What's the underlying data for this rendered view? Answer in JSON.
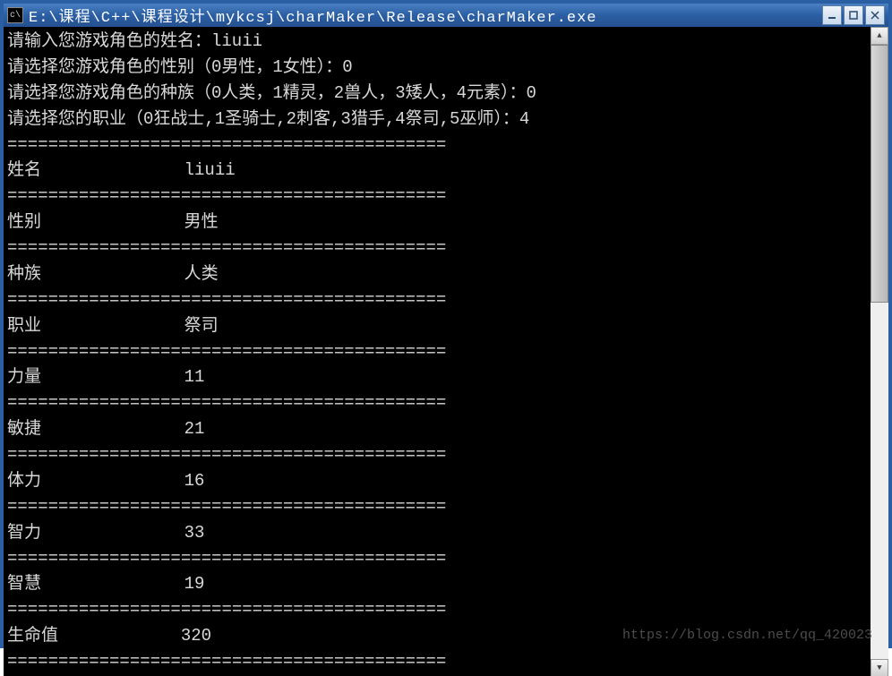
{
  "window": {
    "title": "E:\\课程\\C++\\课程设计\\mykcsj\\charMaker\\Release\\charMaker.exe"
  },
  "prompts": {
    "name_prompt": "请输入您游戏角色的姓名：",
    "name_input": "liuii",
    "gender_prompt": "请选择您游戏角色的性别（0男性，1女性）：",
    "gender_input": "0",
    "race_prompt": "请选择您游戏角色的种族（0人类，1精灵，2兽人，3矮人，4元素）：",
    "race_input": "0",
    "job_prompt": "请选择您的职业（0狂战士,1圣骑士,2刺客,3猎手,4祭司,5巫师）：",
    "job_input": "4"
  },
  "separator": "===========================================",
  "stats": [
    {
      "label": "姓名",
      "value": "liuii"
    },
    {
      "label": "性别",
      "value": "男性"
    },
    {
      "label": "种族",
      "value": "人类"
    },
    {
      "label": "职业",
      "value": "祭司"
    },
    {
      "label": "力量",
      "value": "11"
    },
    {
      "label": "敏捷",
      "value": "21"
    },
    {
      "label": "体力",
      "value": "16"
    },
    {
      "label": "智力",
      "value": "33"
    },
    {
      "label": "智慧",
      "value": "19"
    },
    {
      "label": "生命值",
      "value": "320"
    }
  ],
  "watermark": "https://blog.csdn.net/qq_420023"
}
